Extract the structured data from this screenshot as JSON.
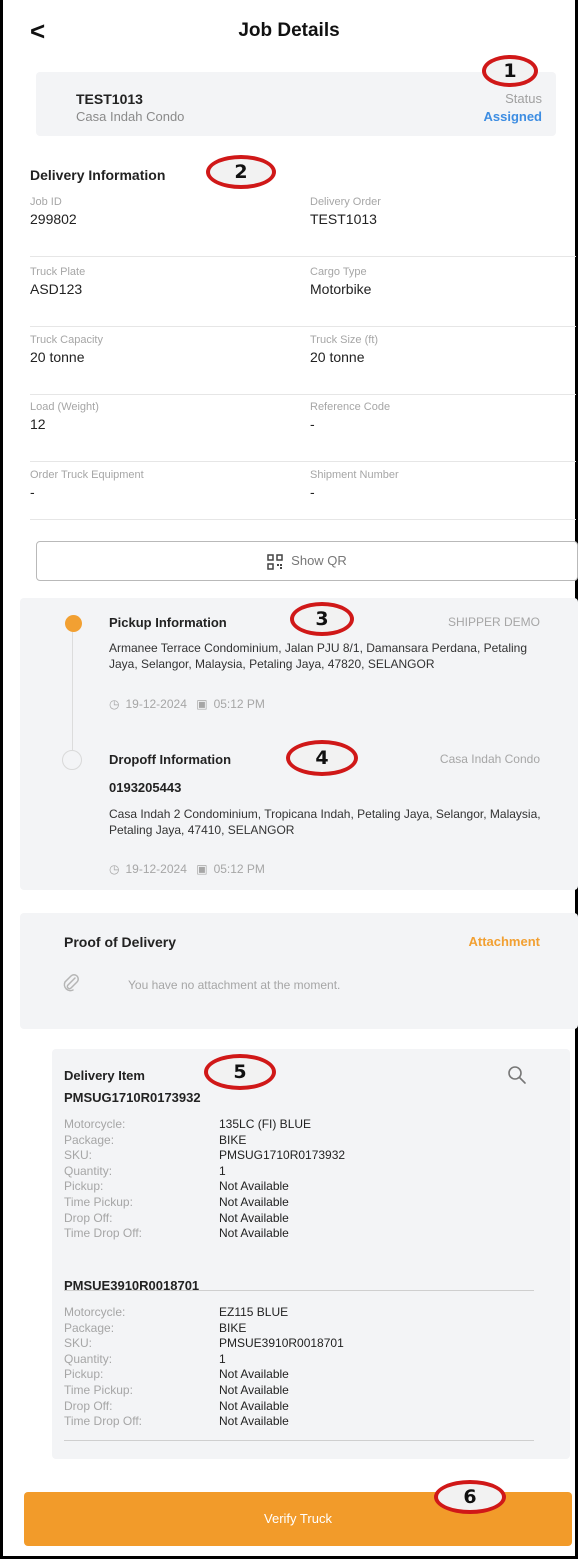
{
  "header": {
    "back": "<",
    "title": "Job Details"
  },
  "markers": [
    "1",
    "2",
    "3",
    "4",
    "5",
    "6"
  ],
  "summary": {
    "code": "TEST1013",
    "name": "Casa Indah Condo",
    "status_label": "Status",
    "status": "Assigned",
    "status_color": "#3d8de2"
  },
  "delivery": {
    "title": "Delivery Information",
    "rows": [
      {
        "l_label": "Job ID",
        "l_value": "299802",
        "r_label": "Delivery Order",
        "r_value": "TEST1013"
      },
      {
        "l_label": "Truck Plate",
        "l_value": "ASD123",
        "r_label": "Cargo Type",
        "r_value": "Motorbike"
      },
      {
        "l_label": "Truck Capacity",
        "l_value": "20 tonne",
        "r_label": "Truck Size (ft)",
        "r_value": "20 tonne"
      },
      {
        "l_label": "Load (Weight)",
        "l_value": "12",
        "r_label": "Reference Code",
        "r_value": "-"
      },
      {
        "l_label": "Order Truck Equipment",
        "l_value": "-",
        "r_label": "Shipment Number",
        "r_value": "-"
      }
    ]
  },
  "qr_button": {
    "label": "Show QR",
    "icon": "qr-code-icon"
  },
  "pickup": {
    "title": "Pickup Information",
    "tag": "SHIPPER DEMO",
    "address": "Armanee Terrace Condominium, Jalan PJU 8/1, Damansara Perdana, Petaling Jaya, Selangor, Malaysia, Petaling Jaya, 47820, SELANGOR",
    "date": "19-12-2024",
    "time": "05:12 PM"
  },
  "dropoff": {
    "title": "Dropoff Information",
    "tag": "Casa Indah Condo",
    "phone": "0193205443",
    "address": "Casa Indah 2 Condominium, Tropicana Indah, Petaling Jaya, Selangor, Malaysia, Petaling Jaya, 47410, SELANGOR",
    "date": "19-12-2024",
    "time": "05:12 PM"
  },
  "proof": {
    "title": "Proof of Delivery",
    "attachment": "Attachment",
    "empty": "You have no attachment at the moment.",
    "accent": "#f2a032"
  },
  "items": {
    "title": "Delivery Item",
    "list": [
      {
        "code": "PMSUG1710R0173932",
        "fields": [
          {
            "k": "Motorcycle:",
            "v": "135LC (FI) BLUE"
          },
          {
            "k": "Package:",
            "v": "BIKE"
          },
          {
            "k": "SKU:",
            "v": "PMSUG1710R0173932"
          },
          {
            "k": "Quantity:",
            "v": "1"
          },
          {
            "k": "Pickup:",
            "v": "Not Available"
          },
          {
            "k": "Time Pickup:",
            "v": "Not Available"
          },
          {
            "k": "Drop Off:",
            "v": "Not Available"
          },
          {
            "k": "Time Drop Off:",
            "v": "Not Available"
          }
        ]
      },
      {
        "code": "PMSUE3910R0018701",
        "fields": [
          {
            "k": "Motorcycle:",
            "v": "EZ115 BLUE"
          },
          {
            "k": "Package:",
            "v": "BIKE"
          },
          {
            "k": "SKU:",
            "v": "PMSUE3910R0018701"
          },
          {
            "k": "Quantity:",
            "v": "1"
          },
          {
            "k": "Pickup:",
            "v": "Not Available"
          },
          {
            "k": "Time Pickup:",
            "v": "Not Available"
          },
          {
            "k": "Drop Off:",
            "v": "Not Available"
          },
          {
            "k": "Time Drop Off:",
            "v": "Not Available"
          }
        ]
      }
    ]
  },
  "verify": {
    "label": "Verify Truck",
    "color": "#f29b2a"
  }
}
